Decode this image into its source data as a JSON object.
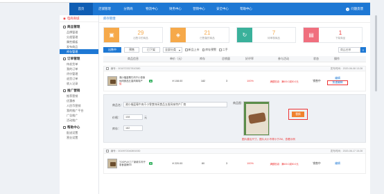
{
  "side_top": "电商商城",
  "nav": {
    "items": [
      "首页",
      "店铺管理",
      "分销商",
      "物流中心",
      "财务中心",
      "营销中心",
      "安全中心",
      "帮助中心"
    ],
    "help": "问题反馈"
  },
  "sidebar": {
    "groups": [
      {
        "title": "商品管理",
        "items": [
          "品牌管理",
          "分类管理",
          "属性模板",
          "发布商品",
          "库存管理"
        ]
      },
      {
        "title": "订单管理",
        "items": [
          "待发货单",
          "我的订单",
          "评价管理",
          "退货订单",
          "收入记录"
        ]
      },
      {
        "title": "推广营销",
        "items": [
          "推荐营销",
          "优惠券",
          "人民币营销",
          "我的推广平台",
          "广告推广",
          "活动推广"
        ]
      },
      {
        "title": "帮助中心",
        "items": [
          "配送设置",
          "营业设置"
        ]
      }
    ]
  },
  "main": {
    "title": "库存管理"
  },
  "stats": [
    {
      "num": "29",
      "label": "出售中的商品",
      "color": "#f6a94a",
      "icon": "bag-icon"
    },
    {
      "num": "21",
      "label": "已售罄的商品",
      "color": "#f6a94a",
      "icon": "tag-icon"
    },
    {
      "num": "7",
      "label": "待审核商品",
      "color": "#3ab19b",
      "icon": "refresh-icon"
    },
    {
      "num": "1",
      "label": "下架商品",
      "color": "#f06f7e",
      "icon": "file-icon"
    }
  ],
  "filters": {
    "tabs": [
      "出售中",
      "预售",
      "已下架"
    ],
    "select": "全部分类",
    "checks": [
      "新品上市",
      "库存预警",
      "二手"
    ],
    "search_placeholder": "商品名称"
  },
  "table": {
    "headers": [
      "商品信息",
      "单价（元）",
      "库存",
      "总销量",
      "好评率",
      "参与活动",
      "状态",
      "操作"
    ]
  },
  "row1": {
    "id": "编号：0018723327810380",
    "time": "发布时间：2020-06-08 13:28",
    "name": "湘小福蓝莓牛肉干小零食休闲食品五香风味特产",
    "price": "¥ 108.00",
    "stock": "182",
    "sales": "3",
    "rate": "100%",
    "activity": "满额抵减：满600.0减50.0元",
    "status": "销售中",
    "op1": "编辑",
    "op2": "快速编辑",
    "tag": "促"
  },
  "edit": {
    "name_label": "商品名：",
    "name_value": "湘小福蓝莓牛肉干小零食休闲食品五香风味特产厂商",
    "price_label": "价格：",
    "price_value": "108",
    "price_unit": "元",
    "stock_label": "库存：",
    "stock_value": "182",
    "image_label": "商品图：",
    "upload": "替换",
    "tip": "图片建议尺寸，图片大小不得小于2M，查看示例"
  },
  "row2": {
    "id": "编号：0019972040891930",
    "time": "发布时间：2020-06-17 15:28",
    "name": "TOOPUX工厂新款牛肉干零食香辣Sh",
    "price": "¥ 220.00",
    "stock": "80",
    "sales": "3",
    "rate": "100%",
    "activity": "满额抵减：满600.0减50.0元",
    "status": "销售中",
    "op1": "编辑"
  }
}
